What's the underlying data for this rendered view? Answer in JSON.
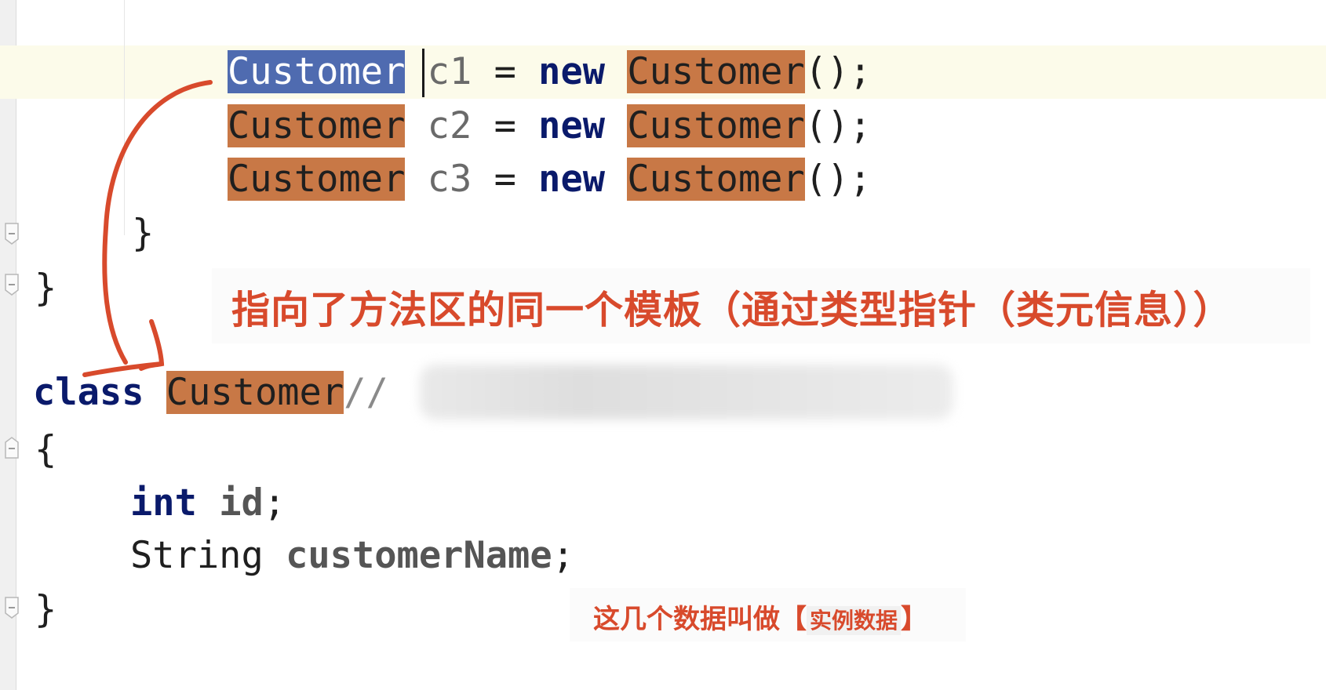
{
  "editor": {
    "lines": [
      {
        "type": "Customer",
        "var": "c1",
        "eq": "=",
        "kw": "new",
        "ctor": "Customer",
        "tail": "();"
      },
      {
        "type": "Customer",
        "var": "c2",
        "eq": "=",
        "kw": "new",
        "ctor": "Customer",
        "tail": "();"
      },
      {
        "type": "Customer",
        "var": "c3",
        "eq": "=",
        "kw": "new",
        "ctor": "Customer",
        "tail": "();"
      }
    ],
    "method_close": "}",
    "outer_close": "}",
    "class_decl": {
      "kw": "class",
      "name": "Customer",
      "comment": "//"
    },
    "class_open": "{",
    "field1": {
      "type": "int",
      "name": "id",
      "end": ";"
    },
    "field2": {
      "type": "String",
      "name": "customerName",
      "end": ";"
    },
    "class_close": "}"
  },
  "annotation": {
    "main": "指向了方法区的同一个模板（通过类型指针（类元信息））",
    "note_prefix": "这几个数据叫做【",
    "note_boxed": "实例数据",
    "note_suffix": "】"
  },
  "colors": {
    "highlight": "#c87846",
    "selection": "#4f6bb0",
    "keyword": "#0a1a6b",
    "annotation_red": "#d84a2c",
    "caret_line": "#fcfbea"
  }
}
